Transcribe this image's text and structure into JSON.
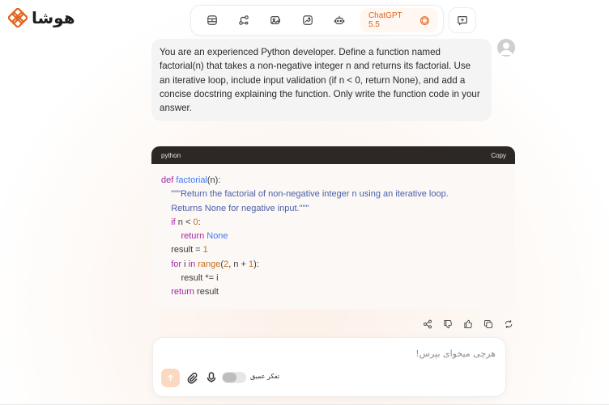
{
  "brand": {
    "name": "هوشا",
    "accent": "#e2621c"
  },
  "toolbar": {
    "icons": [
      "archive-icon",
      "workflow-icon",
      "image-gallery-icon",
      "image-edit-icon",
      "robot-icon"
    ],
    "model_label": "ChatGPT 5.5",
    "model_icon": "openai-icon",
    "new_chat_icon": "new-chat-icon"
  },
  "user_message": {
    "text": "You are an experienced Python developer. Define a function named factorial(n) that takes a non-negative integer n and returns its factorial. Use an iterative loop, include input validation (if n < 0, return None), and add a concise docstring explaining the function. Only write the function code in your answer."
  },
  "code_block": {
    "language": "python",
    "copy_label": "Copy",
    "lines": [
      "def factorial(n):",
      "    \"\"\"Return the factorial of non-negative integer n using an iterative loop.",
      "    Returns None for negative input.\"\"\"",
      "    if n < 0:",
      "        return None",
      "    result = 1",
      "    for i in range(2, n + 1):",
      "        result *= i",
      "    return result"
    ]
  },
  "message_actions": [
    "share-icon",
    "thumbs-down-icon",
    "thumbs-up-icon",
    "copy-icon",
    "regenerate-icon"
  ],
  "composer": {
    "placeholder": "هرچی میخوای بپرس!",
    "deep_think_label": "تفکر عمیق",
    "deep_think_enabled": false
  }
}
